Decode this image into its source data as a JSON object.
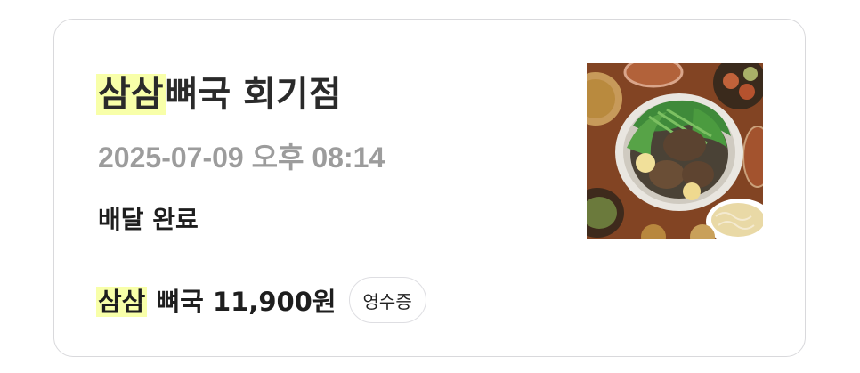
{
  "order": {
    "title_highlight": "삼삼",
    "title_rest": "뼈국 회기점",
    "datetime": "2025-07-09 오후 08:14",
    "status": "배달 완료",
    "menu_highlight": "삼삼",
    "menu_rest": "뼈국 11,900원",
    "receipt_label": "영수증"
  },
  "colors": {
    "highlight": "#f8ffa9",
    "date_gray": "#9c9c9c",
    "card_border": "#d9d9dc"
  }
}
